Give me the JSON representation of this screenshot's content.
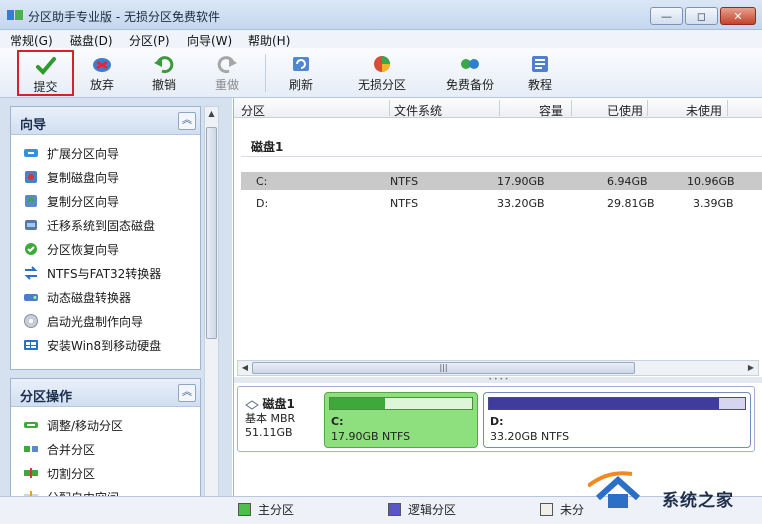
{
  "window": {
    "title": "分区助手专业版 - 无损分区免费软件",
    "controls": {
      "minimize": "—",
      "maximize": "◻",
      "close": "✕"
    }
  },
  "menu": [
    "常规(G)",
    "磁盘(D)",
    "分区(P)",
    "向导(W)",
    "帮助(H)"
  ],
  "toolbar": [
    {
      "label": "提交",
      "icon": "check-icon",
      "enabled": true,
      "highlighted": true
    },
    {
      "label": "放弃",
      "icon": "discard-icon",
      "enabled": true
    },
    {
      "label": "撤销",
      "icon": "undo-icon",
      "enabled": true
    },
    {
      "label": "重做",
      "icon": "redo-icon",
      "enabled": false
    },
    {
      "label": "刷新",
      "icon": "refresh-icon",
      "enabled": true
    },
    {
      "label": "无损分区",
      "icon": "partition-icon",
      "enabled": true
    },
    {
      "label": "免费备份",
      "icon": "backup-icon",
      "enabled": true
    },
    {
      "label": "教程",
      "icon": "tutorial-icon",
      "enabled": true
    }
  ],
  "wizard": {
    "title": "向导",
    "items": [
      "扩展分区向导",
      "复制磁盘向导",
      "复制分区向导",
      "迁移系统到固态磁盘",
      "分区恢复向导",
      "NTFS与FAT32转换器",
      "动态磁盘转换器",
      "启动光盘制作向导",
      "安装Win8到移动硬盘"
    ]
  },
  "partition_ops": {
    "title": "分区操作",
    "items": [
      "调整/移动分区",
      "合并分区",
      "切割分区",
      "分配自由空间"
    ]
  },
  "table": {
    "columns": [
      "分区",
      "文件系统",
      "容量",
      "已使用",
      "未使用"
    ],
    "disk_label": "磁盘1",
    "rows": [
      {
        "name": "C:",
        "fs": "NTFS",
        "capacity": "17.90GB",
        "used": "6.94GB",
        "free": "10.96GB",
        "selected": true
      },
      {
        "name": "D:",
        "fs": "NTFS",
        "capacity": "33.20GB",
        "used": "29.81GB",
        "free": "3.39GB",
        "selected": false
      }
    ]
  },
  "diskmap": {
    "disk_name": "磁盘1",
    "disk_type": "基本 MBR",
    "disk_size": "51.11GB",
    "partitions": [
      {
        "name": "C:",
        "desc": "17.90GB NTFS",
        "used_fraction": 0.39,
        "color": "#8ee07f"
      },
      {
        "name": "D:",
        "desc": "33.20GB NTFS",
        "used_fraction": 0.9,
        "color": "#403c9b"
      }
    ]
  },
  "legend": [
    {
      "label": "主分区",
      "color": "#4cc04a"
    },
    {
      "label": "逻辑分区",
      "color": "#5a56c8"
    },
    {
      "label": "未分",
      "color": "#f0f0e8"
    }
  ],
  "watermark": {
    "text": "系统之家"
  }
}
